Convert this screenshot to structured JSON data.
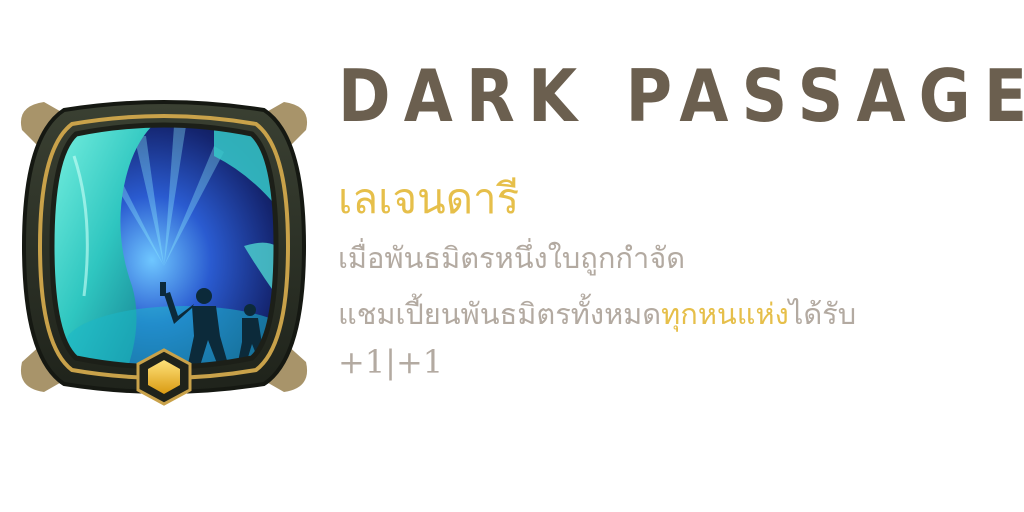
{
  "item": {
    "name": "DARK PASSAGE",
    "rarity": "เลเจนดารี",
    "description": {
      "line1": "เมื่อพันธมิตรหนึ่งใบถูกกำจัด",
      "line2_before": "แชมเปี้ยนพันธมิตรทั้งหมด",
      "line2_highlight": "ทุกหนแห่ง",
      "line2_after": "ได้รับ",
      "stats": "+1|+1"
    },
    "icon": "dark-passage-landmark-icon"
  },
  "colors": {
    "title": "#6b5f4f",
    "rarity": "#e6bf4a",
    "body_text": "#b3aaa1",
    "highlight": "#e6bf4a",
    "frame_outer": "#2e3327",
    "frame_gold": "#c9a24a",
    "art_cyan": "#3ee0d0",
    "gem": "#f2c12e"
  }
}
